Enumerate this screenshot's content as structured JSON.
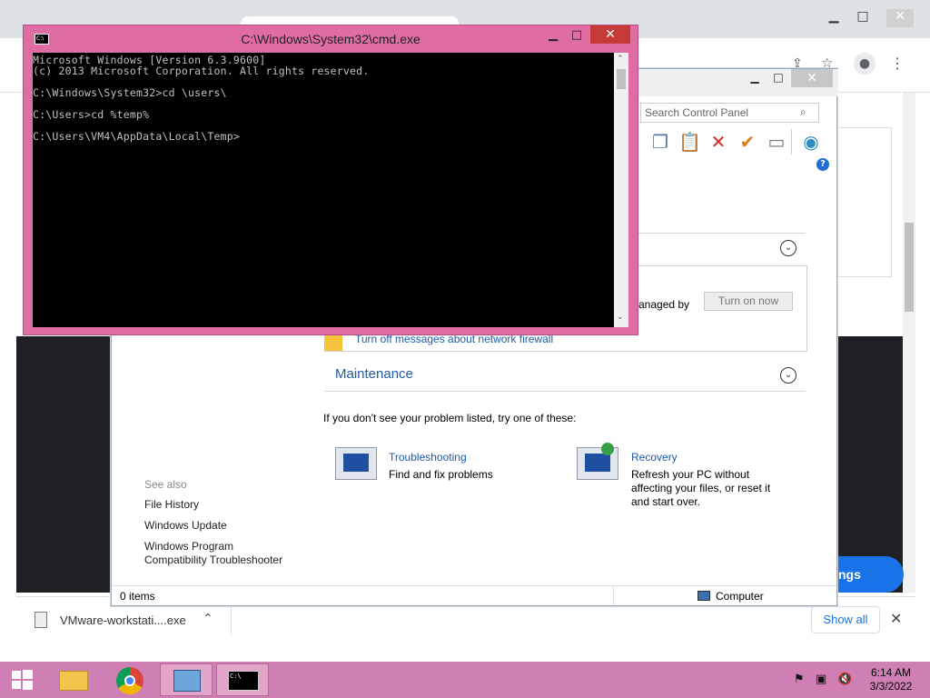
{
  "cmd": {
    "title": "C:\\Windows\\System32\\cmd.exe",
    "icon": "cmd-icon",
    "lines": [
      "Microsoft Windows [Version 6.3.9600]",
      "(c) 2013 Microsoft Corporation. All rights reserved.",
      "",
      "C:\\Windows\\System32>cd \\users\\",
      "",
      "C:\\Users>cd %temp%",
      "",
      "C:\\Users\\VM4\\AppData\\Local\\Temp>"
    ]
  },
  "control_panel": {
    "search_placeholder": "Search Control Panel",
    "toolbar_icons": [
      "copy-icon",
      "paste-icon",
      "delete-icon",
      "check-icon",
      "properties-icon",
      "globe-icon"
    ],
    "security": {
      "managed_text": "anaged by",
      "turn_on_label": "Turn on now",
      "turn_off_link": "Turn off messages about network firewall"
    },
    "maintenance_label": "Maintenance",
    "problem_text": "If you don't see your problem listed, try one of these:",
    "troubleshooting": {
      "title": "Troubleshooting",
      "desc": "Find and fix problems"
    },
    "recovery": {
      "title": "Recovery",
      "desc_1": "Refresh your PC without",
      "desc_2": "affecting your files, or reset it",
      "desc_3": "and start over."
    },
    "see_also": {
      "heading": "See also",
      "file_history": "File History",
      "windows_update": "Windows Update",
      "compat_1": "Windows Program",
      "compat_2": "Compatibility Troubleshooter"
    },
    "status": {
      "items": "0 items",
      "location": "Computer"
    }
  },
  "chrome": {
    "settings_label": "ngs",
    "download_file": "VMware-workstati....exe",
    "show_all": "Show all"
  },
  "taskbar": {
    "time": "6:14 AM",
    "date": "3/3/2022"
  },
  "colors": {
    "accent": "#cf7fb3",
    "cmd_frame": "#e06ca4",
    "link": "#1e5aa8"
  }
}
